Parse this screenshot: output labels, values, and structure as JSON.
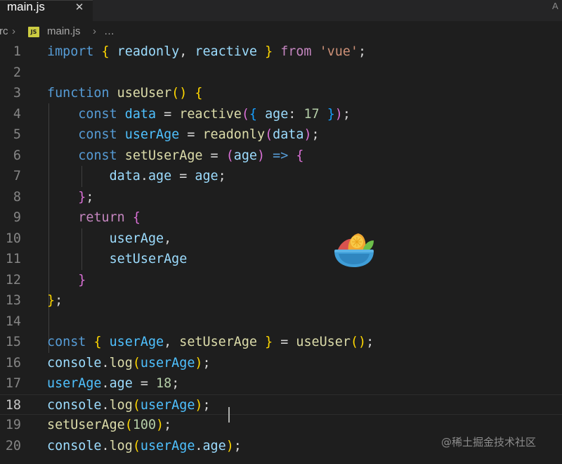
{
  "tab": {
    "label": "main.js",
    "close_glyph": "✕",
    "edge_text": "A"
  },
  "breadcrumb": {
    "folder": "rc",
    "file_icon": "JS",
    "file": "main.js",
    "ellipsis": "…"
  },
  "editor": {
    "current_line": 18,
    "lines": [
      {
        "n": "1",
        "tokens": [
          [
            "kw",
            "import"
          ],
          [
            "p",
            " "
          ],
          [
            "b1",
            "{"
          ],
          [
            "p",
            " "
          ],
          [
            "var",
            "readonly"
          ],
          [
            "p",
            ", "
          ],
          [
            "var",
            "reactive"
          ],
          [
            "p",
            " "
          ],
          [
            "b1",
            "}"
          ],
          [
            "p",
            " "
          ],
          [
            "ctl",
            "from"
          ],
          [
            "p",
            " "
          ],
          [
            "str",
            "'vue'"
          ],
          [
            "p",
            ";"
          ]
        ]
      },
      {
        "n": "2",
        "tokens": []
      },
      {
        "n": "3",
        "tokens": [
          [
            "kw",
            "function"
          ],
          [
            "p",
            " "
          ],
          [
            "fn",
            "useUser"
          ],
          [
            "b1",
            "()"
          ],
          [
            "p",
            " "
          ],
          [
            "b1",
            "{"
          ]
        ]
      },
      {
        "n": "4",
        "tokens": [
          [
            "p",
            "    "
          ],
          [
            "kw",
            "const"
          ],
          [
            "p",
            " "
          ],
          [
            "cst",
            "data"
          ],
          [
            "p",
            " = "
          ],
          [
            "fn",
            "reactive"
          ],
          [
            "b2",
            "("
          ],
          [
            "b3",
            "{"
          ],
          [
            "p",
            " "
          ],
          [
            "var",
            "age"
          ],
          [
            "p",
            ": "
          ],
          [
            "num",
            "17"
          ],
          [
            "p",
            " "
          ],
          [
            "b3",
            "}"
          ],
          [
            "b2",
            ")"
          ],
          [
            "p",
            ";"
          ]
        ]
      },
      {
        "n": "5",
        "tokens": [
          [
            "p",
            "    "
          ],
          [
            "kw",
            "const"
          ],
          [
            "p",
            " "
          ],
          [
            "cst",
            "userAge"
          ],
          [
            "p",
            " = "
          ],
          [
            "fn",
            "readonly"
          ],
          [
            "b2",
            "("
          ],
          [
            "var",
            "data"
          ],
          [
            "b2",
            ")"
          ],
          [
            "p",
            ";"
          ]
        ]
      },
      {
        "n": "6",
        "tokens": [
          [
            "p",
            "    "
          ],
          [
            "kw",
            "const"
          ],
          [
            "p",
            " "
          ],
          [
            "fn",
            "setUserAge"
          ],
          [
            "p",
            " = "
          ],
          [
            "b2",
            "("
          ],
          [
            "var",
            "age"
          ],
          [
            "b2",
            ")"
          ],
          [
            "p",
            " "
          ],
          [
            "kw",
            "=>"
          ],
          [
            "p",
            " "
          ],
          [
            "b2",
            "{"
          ]
        ]
      },
      {
        "n": "7",
        "tokens": [
          [
            "p",
            "        "
          ],
          [
            "var",
            "data"
          ],
          [
            "p",
            "."
          ],
          [
            "var",
            "age"
          ],
          [
            "p",
            " = "
          ],
          [
            "var",
            "age"
          ],
          [
            "p",
            ";"
          ]
        ]
      },
      {
        "n": "8",
        "tokens": [
          [
            "p",
            "    "
          ],
          [
            "b2",
            "}"
          ],
          [
            "p",
            ";"
          ]
        ]
      },
      {
        "n": "9",
        "tokens": [
          [
            "p",
            "    "
          ],
          [
            "ctl",
            "return"
          ],
          [
            "p",
            " "
          ],
          [
            "b2",
            "{"
          ]
        ]
      },
      {
        "n": "10",
        "tokens": [
          [
            "p",
            "        "
          ],
          [
            "var",
            "userAge"
          ],
          [
            "p",
            ","
          ]
        ]
      },
      {
        "n": "11",
        "tokens": [
          [
            "p",
            "        "
          ],
          [
            "var",
            "setUserAge"
          ]
        ]
      },
      {
        "n": "12",
        "tokens": [
          [
            "p",
            "    "
          ],
          [
            "b2",
            "}"
          ]
        ]
      },
      {
        "n": "13",
        "tokens": [
          [
            "b1",
            "}"
          ],
          [
            "p",
            ";"
          ]
        ]
      },
      {
        "n": "14",
        "tokens": []
      },
      {
        "n": "15",
        "tokens": [
          [
            "kw",
            "const"
          ],
          [
            "p",
            " "
          ],
          [
            "b1",
            "{"
          ],
          [
            "p",
            " "
          ],
          [
            "cst",
            "userAge"
          ],
          [
            "p",
            ", "
          ],
          [
            "fn",
            "setUserAge"
          ],
          [
            "p",
            " "
          ],
          [
            "b1",
            "}"
          ],
          [
            "p",
            " = "
          ],
          [
            "fn",
            "useUser"
          ],
          [
            "b1",
            "()"
          ],
          [
            "p",
            ";"
          ]
        ]
      },
      {
        "n": "16",
        "tokens": [
          [
            "var",
            "console"
          ],
          [
            "p",
            "."
          ],
          [
            "fn",
            "log"
          ],
          [
            "b1",
            "("
          ],
          [
            "cst",
            "userAge"
          ],
          [
            "b1",
            ")"
          ],
          [
            "p",
            ";"
          ]
        ]
      },
      {
        "n": "17",
        "tokens": [
          [
            "cst",
            "userAge"
          ],
          [
            "p",
            "."
          ],
          [
            "var",
            "age"
          ],
          [
            "p",
            " = "
          ],
          [
            "num",
            "18"
          ],
          [
            "p",
            ";"
          ]
        ]
      },
      {
        "n": "18",
        "tokens": [
          [
            "var",
            "console"
          ],
          [
            "p",
            "."
          ],
          [
            "fn",
            "log"
          ],
          [
            "b1",
            "("
          ],
          [
            "cst",
            "userAge"
          ],
          [
            "b1",
            ")"
          ],
          [
            "p",
            ";"
          ]
        ]
      },
      {
        "n": "19",
        "tokens": [
          [
            "fn",
            "setUserAge"
          ],
          [
            "b1",
            "("
          ],
          [
            "num",
            "100"
          ],
          [
            "b1",
            ")"
          ],
          [
            "p",
            ";"
          ]
        ]
      },
      {
        "n": "20",
        "tokens": [
          [
            "var",
            "console"
          ],
          [
            "p",
            "."
          ],
          [
            "fn",
            "log"
          ],
          [
            "b1",
            "("
          ],
          [
            "cst",
            "userAge"
          ],
          [
            "p",
            "."
          ],
          [
            "var",
            "age"
          ],
          [
            "b1",
            ")"
          ],
          [
            "p",
            ";"
          ]
        ]
      }
    ]
  },
  "logo": {
    "name": "fruit-bowl-logo"
  },
  "watermark": {
    "text": "@稀土掘金技术社区"
  },
  "colors": {
    "background": "#1e1e1e",
    "keyword": "#569cd6",
    "control": "#c586c0",
    "function": "#dcdcaa",
    "variable": "#9cdcfe",
    "constant": "#4fc1ff",
    "string": "#ce9178",
    "number": "#b5cea8"
  }
}
